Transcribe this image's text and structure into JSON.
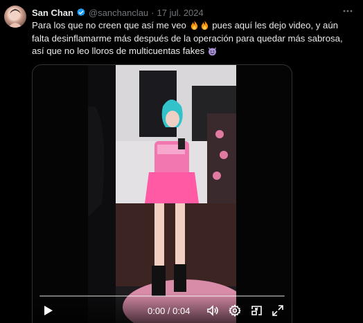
{
  "tweet": {
    "author_name": "San Chan",
    "handle": "@sanchanclau",
    "separator": "·",
    "date": "17 jul. 2024",
    "text_parts": {
      "p1": "Para los que no creen que así me veo ",
      "p2": " pues aquí les dejo video, y aún falta desinflamarme más después de la operación para quedar más sabrosa, así que no leo lloros de multicuentas fakes "
    },
    "emojis": [
      "fire-emoji",
      "fire-emoji",
      "smiling-devil-emoji"
    ]
  },
  "video": {
    "time_display": "0:00 / 0:04",
    "progress": 0.0,
    "icons": [
      "play-icon",
      "volume-icon",
      "settings-icon",
      "pip-icon",
      "fullscreen-icon"
    ]
  },
  "colors": {
    "background": "#000000",
    "text": "#e7e9ea",
    "muted": "#71767b",
    "verified": "#1d9bf0",
    "border": "#2f3336"
  }
}
